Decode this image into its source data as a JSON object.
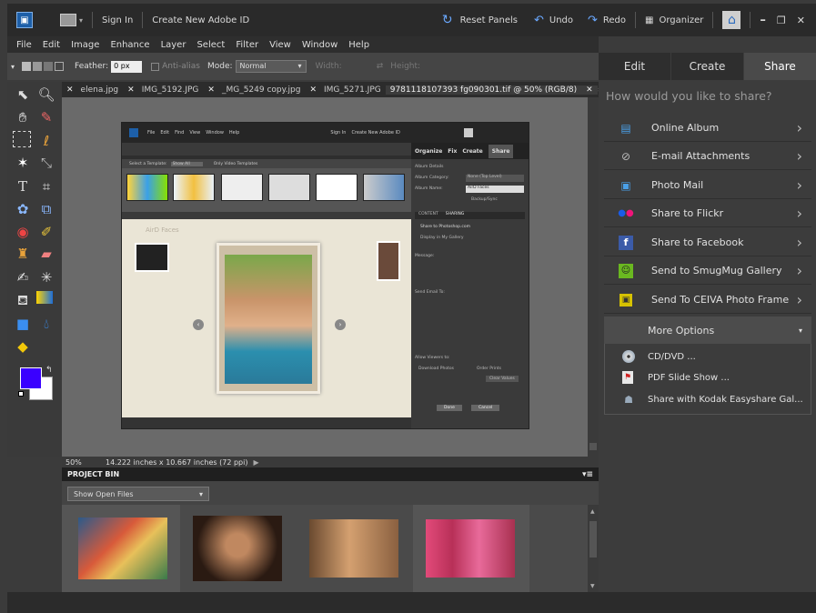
{
  "titlebar": {
    "sign_in": "Sign In",
    "create_id": "Create New Adobe ID",
    "reset_panels": "Reset Panels",
    "undo": "Undo",
    "redo": "Redo",
    "organizer": "Organizer",
    "minimize": "–",
    "restore": "❐",
    "close": "✕"
  },
  "menu": [
    "File",
    "Edit",
    "Image",
    "Enhance",
    "Layer",
    "Select",
    "Filter",
    "View",
    "Window",
    "Help"
  ],
  "options": {
    "feather_label": "Feather:",
    "feather_value": "0 px",
    "antialias": "Anti-alias",
    "mode_label": "Mode:",
    "mode_value": "Normal",
    "width": "Width:",
    "height": "Height:"
  },
  "tabs": [
    "elena.jpg",
    "IMG_5192.JPG",
    "_MG_5249 copy.jpg",
    "IMG_5271.JPG",
    "9781118107393 fg090301.tif @ 50% (RGB/8)"
  ],
  "status": {
    "zoom": "50%",
    "size": "14.222 inches x 10.667 inches (72 ppi)"
  },
  "bin": {
    "title": "PROJECT BIN",
    "show": "Show Open Files"
  },
  "panel": {
    "tabs": [
      "Edit",
      "Create",
      "Share"
    ],
    "question": "How would you like to share?",
    "items": [
      {
        "label": "Online Album",
        "icon": "online-album-icon"
      },
      {
        "label": "E-mail Attachments",
        "icon": "paperclip-icon"
      },
      {
        "label": "Photo Mail",
        "icon": "photo-mail-icon"
      },
      {
        "label": "Share to Flickr",
        "icon": "flickr-icon"
      },
      {
        "label": "Share to Facebook",
        "icon": "facebook-icon"
      },
      {
        "label": "Send to SmugMug Gallery",
        "icon": "smugmug-icon"
      },
      {
        "label": "Send To CEIVA Photo Frame",
        "icon": "ceiva-icon"
      }
    ],
    "more_options": "More Options",
    "more": [
      {
        "label": "CD/DVD ...",
        "icon": "disc-icon"
      },
      {
        "label": "PDF Slide Show ...",
        "icon": "pdf-icon"
      },
      {
        "label": "Share with Kodak Easyshare Gal...",
        "icon": "kodak-icon"
      }
    ]
  },
  "inner": {
    "menu": [
      "File",
      "Edit",
      "Find",
      "View",
      "Window",
      "Help"
    ],
    "sign_in": "Sign In",
    "create_id": "Create New Adobe ID",
    "tabs": [
      "Organize",
      "Fix",
      "Create",
      "Share"
    ],
    "select_template": "Select a Template:",
    "show_all": "Show All",
    "only_video": "Only Video Templates",
    "album_details": "Album Details",
    "album_category": "Album Category:",
    "category_value": "None (Top Level)",
    "album_name": "Album Name:",
    "album_name_value": "AirD Faces",
    "backup": "Backup/Sync",
    "content_tab": "CONTENT",
    "sharing_tab": "SHARING",
    "share_photoshop": "Share to Photoshop.com",
    "display_gallery": "Display in My Gallery",
    "message": "Message:",
    "send_email": "Send Email To:",
    "allow_viewers": "Allow Viewers to:",
    "download_photos": "Download Photos",
    "order_prints": "Order Prints",
    "clear_values": "Clear Values",
    "done": "Done",
    "cancel": "Cancel",
    "album_title": "AirD Faces"
  }
}
